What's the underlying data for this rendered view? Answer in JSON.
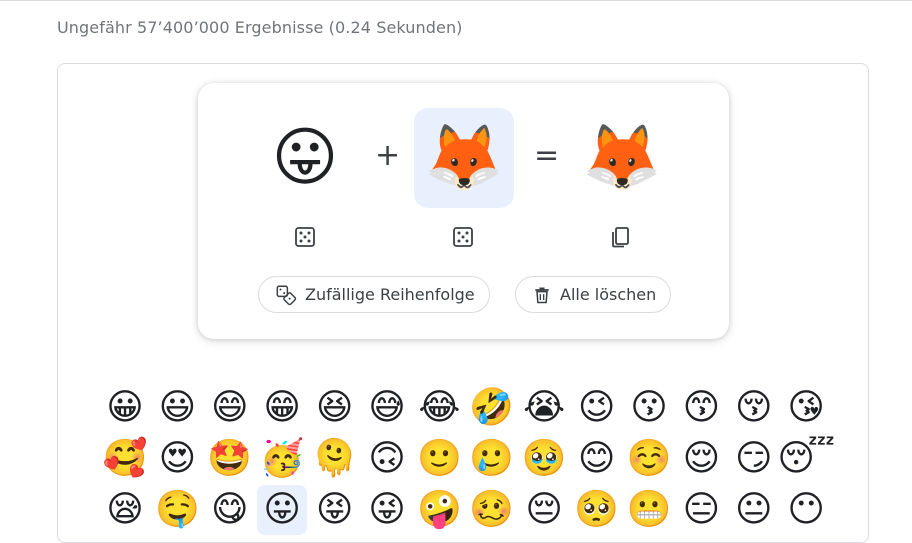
{
  "results": {
    "text": "Ungefähr 57’400’000 Ergebnisse (0.24 Sekunden)"
  },
  "mixer": {
    "left_emoji": "😛",
    "right_emoji": "🦊",
    "result_emoji": "🦊",
    "plus": "+",
    "equals": "=",
    "shuffle_label": "Zufällige Reihenfolge",
    "clear_label": "Alle löschen"
  },
  "palette": {
    "rows": [
      [
        "😀",
        "😃",
        "😄",
        "😁",
        "😆",
        "😅",
        "😂",
        "🤣",
        "😭",
        "😉",
        "😗",
        "😙",
        "😚",
        "😘"
      ],
      [
        "🥰",
        "😍",
        "🤩",
        "🥳",
        "🫠",
        "🙃",
        "🙂",
        "🥲",
        "🥹",
        "😊",
        "☺️",
        "😌",
        "😏",
        "😴"
      ],
      [
        "😪",
        "🤤",
        "😋",
        "😛",
        "😝",
        "😜",
        "🤪",
        "🥴",
        "😔",
        "🥺",
        "😬",
        "😑",
        "😐",
        "😶"
      ]
    ],
    "selected_row": 2,
    "selected_col": 3
  },
  "colors": {
    "selected_bg": "#e8f0fe",
    "border": "#dadce0",
    "muted_text": "#70757a"
  }
}
